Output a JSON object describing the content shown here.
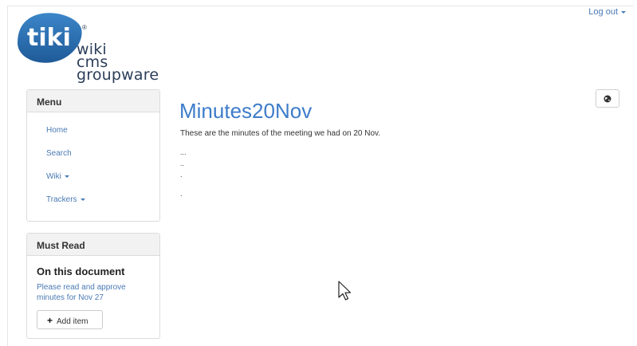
{
  "header": {
    "logout_label": "Log out"
  },
  "logo": {
    "badge_text": "tiki",
    "registered": "®",
    "lines": [
      "wiki",
      "cms",
      "groupware"
    ]
  },
  "menu": {
    "title": "Menu",
    "items": [
      {
        "label": "Home",
        "dropdown": false
      },
      {
        "label": "Search",
        "dropdown": false
      },
      {
        "label": "Wiki",
        "dropdown": true
      },
      {
        "label": "Trackers",
        "dropdown": true
      }
    ]
  },
  "must_read": {
    "title": "Must Read",
    "heading": "On this document",
    "link": "Please read and approve minutes for Nov 27",
    "add_label": "Add item"
  },
  "content": {
    "title": "Minutes20Nov",
    "intro": "These are the minutes of the meeting we had on 20 Nov.",
    "bullets": [
      "...",
      "..",
      ".",
      "."
    ]
  },
  "icons": {
    "globe": "globe-icon",
    "cursor": "mouse-cursor-icon"
  },
  "colors": {
    "accent": "#3d7cc9",
    "link": "#4a7ab5",
    "logo_blue": "#2b6bb0"
  }
}
